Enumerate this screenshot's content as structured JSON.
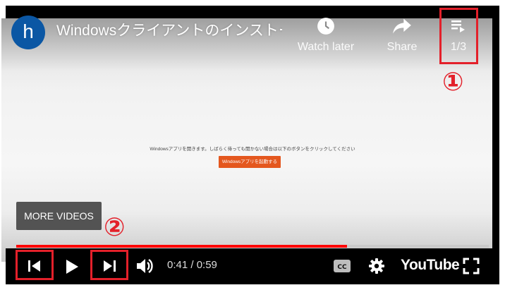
{
  "channel": {
    "avatar_letter": "h"
  },
  "video": {
    "title": "Windowsクライアントのインストール",
    "message": "Windowsアプリを開きます。しばらく待っても開かない場合は以下のボタンをクリックしてください",
    "launch_button": "Windowsアプリを起動する"
  },
  "top_actions": {
    "watch_later": "Watch later",
    "share": "Share",
    "playlist_position": "1/3"
  },
  "more_videos": "MORE VIDEOS",
  "annotations": {
    "one": "①",
    "two": "②"
  },
  "player": {
    "current_time": "0:41",
    "duration": "0:59",
    "time_display": "0:41 / 0:59",
    "progress": 0.7,
    "logo_text": "YouTube"
  },
  "colors": {
    "annotation_red": "#e3202a",
    "progress_red": "#ff0000",
    "avatar_blue": "#0b57a4",
    "launch_orange": "#e4571e"
  },
  "icons": [
    "clock-icon",
    "share-arrow-icon",
    "playlist-icon",
    "previous-icon",
    "play-icon",
    "next-icon",
    "volume-icon",
    "captions-icon",
    "settings-gear-icon",
    "fullscreen-icon"
  ]
}
